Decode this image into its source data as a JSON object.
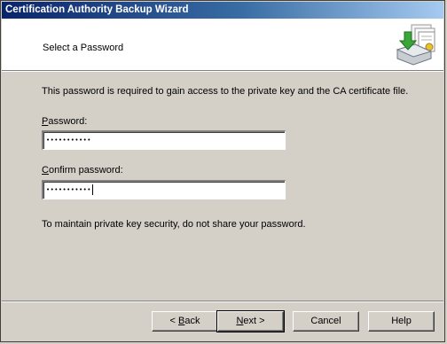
{
  "window": {
    "title": "Certification Authority Backup Wizard"
  },
  "header": {
    "subtitle": "Select a Password",
    "icon": "backup-wizard-icon"
  },
  "main": {
    "description": "This password is required to gain access to the private key and the CA certificate file.",
    "password": {
      "label_access": "P",
      "label_rest": "assword:",
      "value": "•••••••••••"
    },
    "confirm": {
      "label_access": "C",
      "label_rest": "onfirm password:",
      "value": "•••••••••••"
    },
    "note": "To maintain private key security, do not share your password."
  },
  "buttons": {
    "back_prefix": "< ",
    "back_access": "B",
    "back_rest": "ack",
    "next_access": "N",
    "next_rest": "ext >",
    "cancel": "Cancel",
    "help": "Help"
  }
}
